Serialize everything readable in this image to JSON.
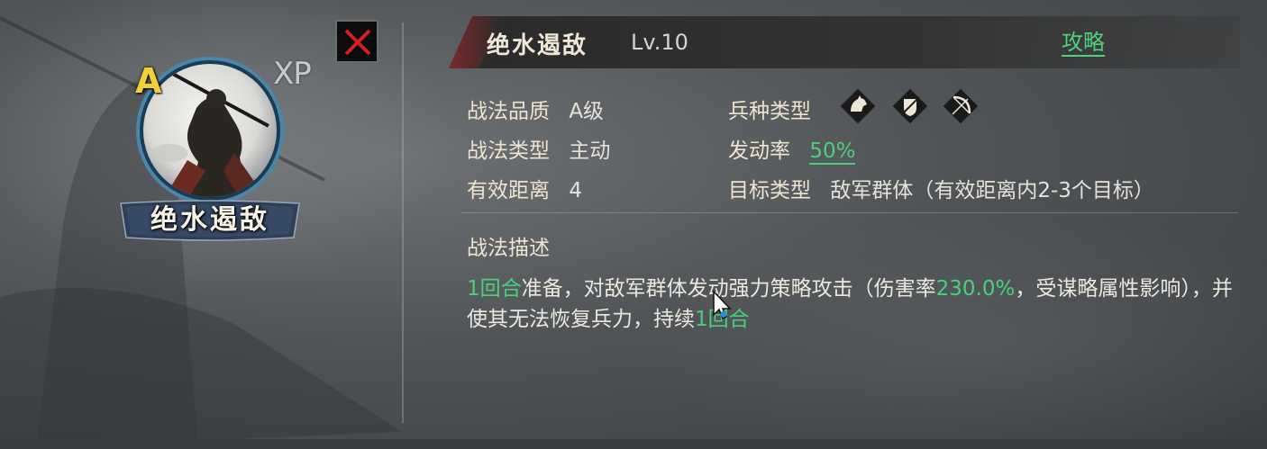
{
  "hero": {
    "grade": "A",
    "xp_label": "XP",
    "name_plate": "绝水遏敌"
  },
  "header": {
    "skill_name": "绝水遏敌",
    "level": "Lv.10",
    "guide_link": "攻略"
  },
  "attributes": {
    "quality": {
      "label": "战法品质",
      "value": "A级"
    },
    "skill_type": {
      "label": "战法类型",
      "value": "主动"
    },
    "range": {
      "label": "有效距离",
      "value": "4"
    },
    "troop_type": {
      "label": "兵种类型",
      "icons": [
        "cavalry-icon",
        "shield-infantry-icon",
        "bow-archer-icon"
      ]
    },
    "trigger_rate": {
      "label": "发动率",
      "value": "50%"
    },
    "target_type": {
      "label": "目标类型",
      "value": "敌军群体（有效距离内2-3个目标）"
    }
  },
  "description": {
    "title": "战法描述",
    "seg1": "1回合",
    "seg2": "准备，对敌军群体发动强力策略攻击（伤害率",
    "seg3": "230.0%",
    "seg4": "，受谋略属性影响），并使其无法恢复兵力，持续",
    "seg5": "1回合"
  },
  "colors": {
    "highlight": "#4cce7c",
    "grade": "#f1cf39",
    "close_x": "#d21f1f"
  }
}
